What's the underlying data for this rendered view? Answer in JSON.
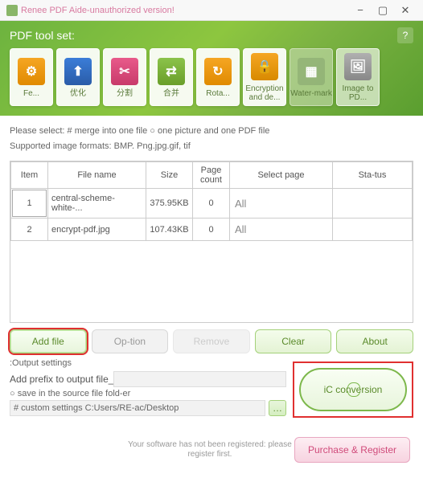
{
  "window": {
    "title": "Renee PDF Aide-unauthorized version!"
  },
  "header": {
    "title": "PDF tool set:"
  },
  "tools": [
    {
      "label": "Fe..."
    },
    {
      "label": "优化"
    },
    {
      "label": "分割"
    },
    {
      "label": "合并"
    },
    {
      "label": "Rota..."
    },
    {
      "label": "Encryption and de..."
    },
    {
      "label": "Water-mark"
    },
    {
      "label": "Image to PD..."
    }
  ],
  "instruction": "Please select: # merge into one file ○ one picture and one PDF file",
  "formats": "Supported image formats: BMP. Png.jpg.gif, tif",
  "table": {
    "headers": {
      "item": "Item",
      "filename": "File name",
      "size": "Size",
      "pagecount": "Page count",
      "selectpage": "Select page",
      "status": "Sta-tus"
    },
    "rows": [
      {
        "item": "1",
        "filename": "central-scheme-white-...",
        "size": "375.95KB",
        "pagecount": "0",
        "selectpage": "All",
        "status": ""
      },
      {
        "item": "2",
        "filename": "encrypt-pdf.jpg",
        "size": "107.43KB",
        "pagecount": "0",
        "selectpage": "All",
        "status": ""
      }
    ]
  },
  "actions": {
    "add": "Add file",
    "option": "Op-tion",
    "remove": "Remove",
    "clear": "Clear",
    "about": "About"
  },
  "output": {
    "label": ":Output settings",
    "prefix_label": "Add prefix to output file_",
    "radio1": "○ save in the source file fold-er",
    "path": "# custom settings C:Users/RE-ac/Desktop"
  },
  "convert": {
    "label": "iC conversion"
  },
  "footer": {
    "reg": "Your software has not been registered: please register first.",
    "purchase": "Purchase & Register"
  }
}
